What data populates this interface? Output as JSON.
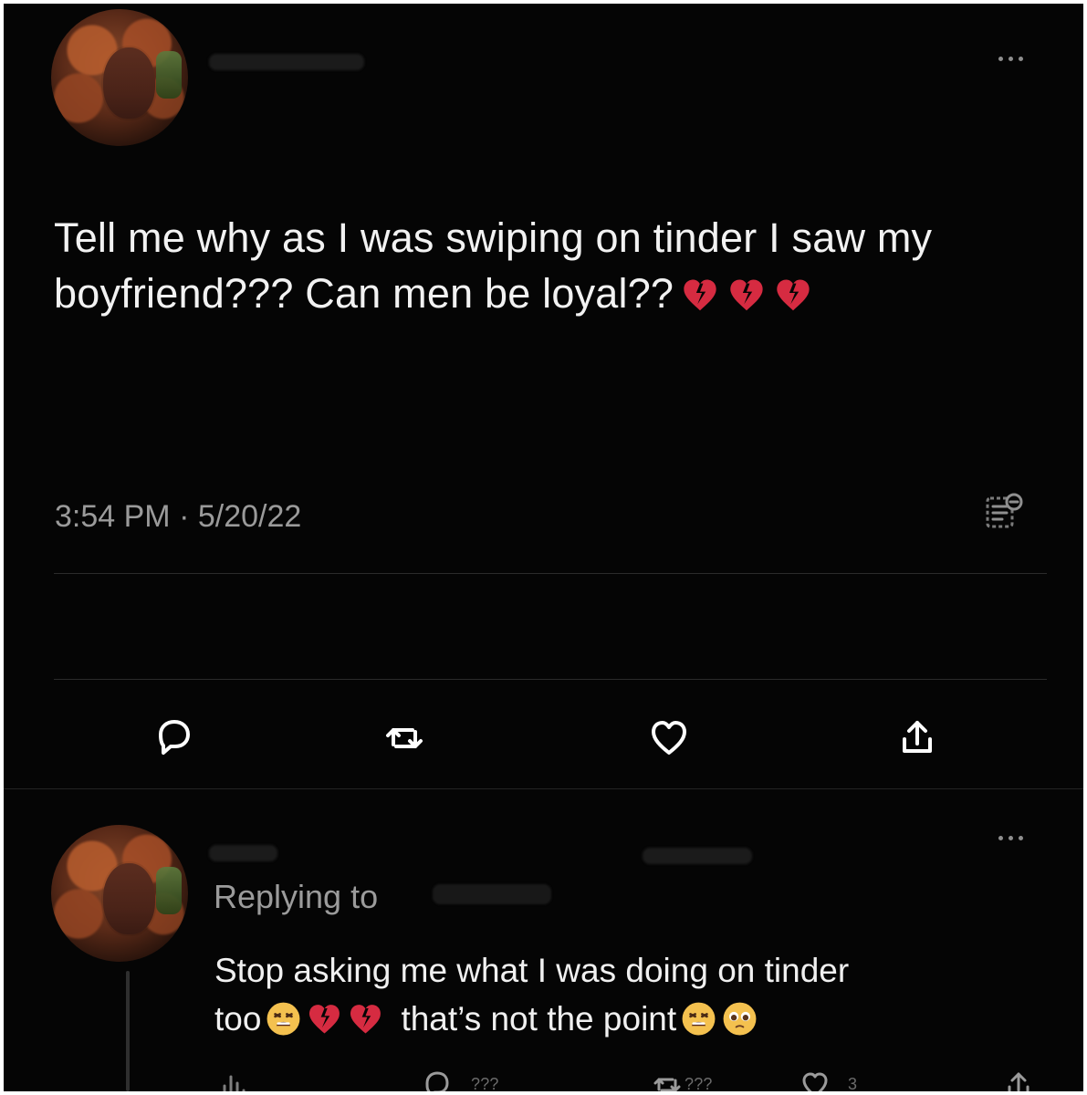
{
  "tweet": {
    "text": "Tell me why as I was swiping on tinder I saw my boyfriend??? Can men be loyal??",
    "time": "3:54 PM",
    "date": "5/20/22",
    "meta_separator": " · ",
    "emoji": [
      "broken-heart",
      "broken-heart",
      "broken-heart"
    ]
  },
  "reply": {
    "replying_to_label": "Replying to",
    "line1": "Stop asking me what I was doing on tinder",
    "line2_prefix": "too",
    "line2_middle": "that’s not the point",
    "emoji_group_1": [
      "tired-face",
      "broken-heart",
      "broken-heart"
    ],
    "emoji_group_2": [
      "tired-face",
      "pleading-face"
    ],
    "counts": {
      "replies": "???",
      "retweets": "???",
      "likes": "3"
    }
  },
  "icons": {
    "reply": "reply-icon",
    "retweet": "retweet-icon",
    "like": "heart-icon",
    "share": "share-icon",
    "analytics": "analytics-icon",
    "more": "more-options-icon",
    "source": "source-icon"
  },
  "colors": {
    "background": "#050505",
    "text": "#f2f2f2",
    "muted": "#9a9a9a",
    "rule": "#2b2b2b",
    "broken_heart": "#d62b41"
  }
}
